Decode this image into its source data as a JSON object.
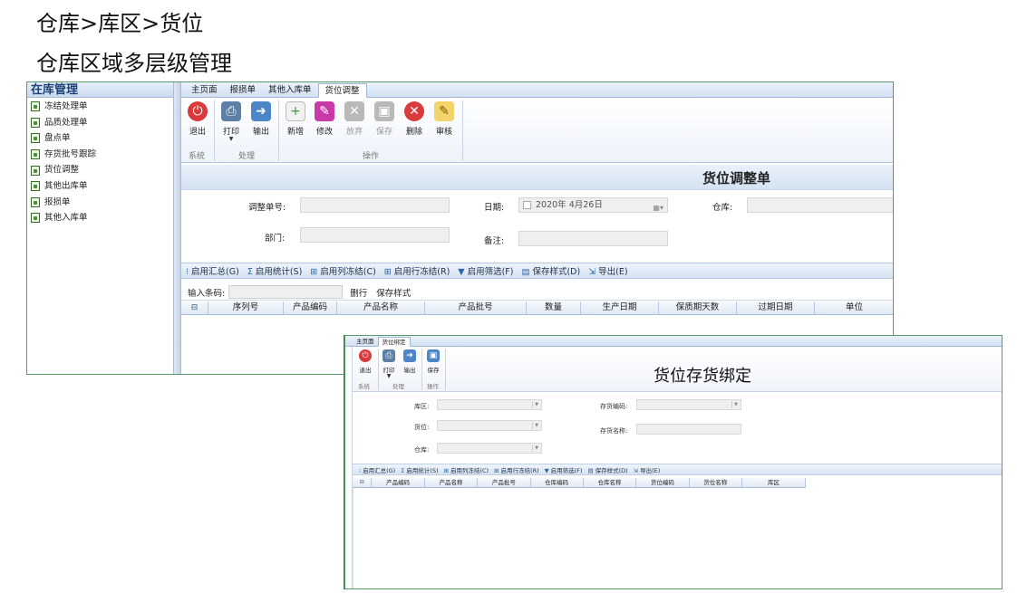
{
  "headings": {
    "breadcrumb": "仓库>库区>货位",
    "subtitle": "仓库区域多层级管理"
  },
  "window1": {
    "sidebar": {
      "title": "在库管理",
      "items": [
        "冻结处理单",
        "品质处理单",
        "盘点单",
        "存货批号跟踪",
        "货位调整",
        "其他出库单",
        "报损单",
        "其他入库单"
      ]
    },
    "tabs": [
      "主页面",
      "报损单",
      "其他入库单",
      "货位调整"
    ],
    "active_tab": "货位调整",
    "ribbon": {
      "buttons": {
        "exit": "退出",
        "print": "打印",
        "export": "输出",
        "new": "新增",
        "edit": "修改",
        "discard": "放弃",
        "save": "保存",
        "delete": "删除",
        "audit": "审核"
      },
      "groups": {
        "system": "系统",
        "process": "处理",
        "operate": "操作"
      }
    },
    "form": {
      "title": "货位调整单",
      "labels": {
        "order_no": "调整单号:",
        "date": "日期:",
        "warehouse": "仓库:",
        "department": "部门:",
        "remark": "备注:"
      },
      "values": {
        "date": "2020年 4月26日"
      }
    },
    "toolbar": [
      "启用汇总(G)",
      "启用统计(S)",
      "启用列冻结(C)",
      "启用行冻结(R)",
      "启用筛选(F)",
      "保存样式(D)",
      "导出(E)"
    ],
    "code_strip": {
      "label": "输入条码:",
      "delete_row": "删行",
      "save_style": "保存样式"
    },
    "grid_columns": [
      "序列号",
      "产品编码",
      "产品名称",
      "产品批号",
      "数量",
      "生产日期",
      "保质期天数",
      "过期日期",
      "单位"
    ]
  },
  "window2": {
    "tabs": [
      "主页面",
      "货位绑定"
    ],
    "active_tab": "货位绑定",
    "ribbon": {
      "buttons": {
        "exit": "退出",
        "print": "打印",
        "export": "输出",
        "save": "保存"
      },
      "groups": {
        "system": "系统",
        "process": "处理",
        "operate": "操作"
      }
    },
    "title": "货位存货绑定",
    "labels": {
      "zone": "库区:",
      "location": "货位:",
      "warehouse": "仓库:",
      "inv_code": "存货编码:",
      "inv_name": "存货名称:"
    },
    "toolbar": [
      "启用汇总(G)",
      "启用统计(S)",
      "启用列冻结(C)",
      "启用行冻结(R)",
      "启用筛选(F)",
      "保存样式(D)",
      "导出(E)"
    ],
    "grid_columns": [
      "产品编码",
      "产品名称",
      "产品批号",
      "仓库编码",
      "仓库名称",
      "货位编码",
      "货位名称",
      "库区"
    ]
  }
}
